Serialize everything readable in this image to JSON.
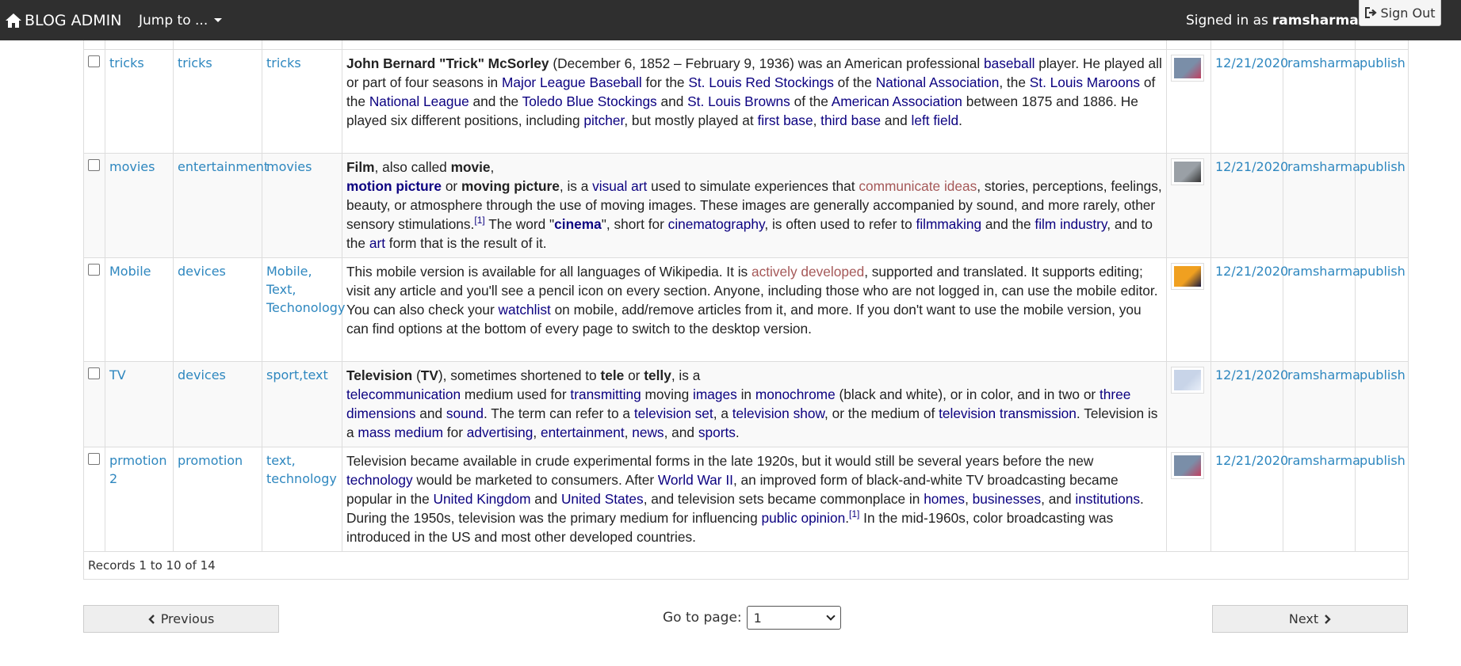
{
  "navbar": {
    "brand": "BLOG ADMIN",
    "jump_to": "Jump to ...",
    "signed_in_prefix": "Signed in as",
    "username": "ramsharma",
    "sign_out": "Sign Out"
  },
  "rows": [
    {
      "title": "tricks",
      "category": "tricks",
      "tags": "tricks",
      "thumb_colors": [
        "#7a8ea8",
        "#c04060"
      ],
      "date": "12/21/2020",
      "author": "ramsharma",
      "status": "publish"
    },
    {
      "title": "movies",
      "category": "entertainment",
      "tags": "movies",
      "thumb_colors": [
        "#9aa0a6",
        "#333333"
      ],
      "date": "12/21/2020",
      "author": "ramsharma",
      "status": "publish"
    },
    {
      "title": "Mobile",
      "category": "devices",
      "tags": "Mobile, Text, Techonology",
      "thumb_colors": [
        "#f0a020",
        "#1a1a40"
      ],
      "date": "12/21/2020",
      "author": "ramsharma",
      "status": "publish"
    },
    {
      "title": "TV",
      "category": "devices",
      "tags": "sport,text",
      "thumb_colors": [
        "#c8d4e8",
        "#e8eef8"
      ],
      "date": "12/21/2020",
      "author": "ramsharma",
      "status": "publish"
    },
    {
      "title": "prmotion 2",
      "category": "promotion",
      "tags": "text, technology",
      "thumb_colors": [
        "#7a8ea8",
        "#c04060"
      ],
      "date": "12/21/2020",
      "author": "ramsharma",
      "status": "publish"
    }
  ],
  "body_texts": {
    "r1": [
      "John Bernard \"Trick\" McSorley",
      " (December 6, 1852 – February 9, 1936) was an American professional ",
      "baseball",
      " player. He played all or part of four seasons in ",
      "Major League Baseball",
      " for the ",
      "St. Louis Red Stockings",
      " of the ",
      "National Association",
      ", the ",
      "St. Louis Maroons",
      " of the ",
      "National League",
      " and the ",
      "Toledo Blue Stockings",
      " and ",
      "St. Louis Browns",
      " of the ",
      "American Association",
      " between 1875 and 1886. He played six different positions, including ",
      "pitcher",
      ", but mostly played at ",
      "first base",
      ", ",
      "third base",
      " and ",
      "left field",
      "."
    ],
    "r2": [
      "Film",
      ", also called ",
      "movie",
      ",",
      "motion picture",
      " or ",
      "moving picture",
      ", is a ",
      "visual art",
      " used to simulate experiences that ",
      "communicate ideas",
      ", stories, perceptions, feelings, beauty, or atmosphere through the use of moving images. These images are generally accompanied by sound, and more rarely, other sensory stimulations.",
      "[1]",
      " The word \"",
      "cinema",
      "\", short for ",
      "cinematography",
      ", is often used to refer to ",
      "filmmaking",
      " and the ",
      "film industry",
      ", and to the ",
      "art",
      " form that is the result of it."
    ],
    "r3": [
      "This mobile version is available for all languages of Wikipedia. It is ",
      "actively developed",
      ", supported and translated. It supports editing; visit any article and you'll see a pencil icon on every section. Anyone, including those who are not logged in, can use the mobile editor. You can also check your ",
      "watchlist",
      " on mobile, add/remove articles from it, and more. If you don't want to use the mobile version, you can find options at the bottom of every page to switch to the desktop version."
    ],
    "r4": [
      "Television",
      " (",
      "TV",
      "), sometimes shortened to ",
      "tele",
      " or ",
      "telly",
      ", is a ",
      "telecommunication",
      " medium used for ",
      "transmitting",
      " moving ",
      "images",
      " in ",
      "monochrome",
      " (black and white), or in color, and in two or ",
      "three dimensions",
      " and ",
      "sound",
      ". The term can refer to a ",
      "television set",
      ", a ",
      "television show",
      ", or the medium of ",
      "television transmission",
      ". Television is a ",
      "mass medium",
      " for ",
      "advertising",
      ", ",
      "entertainment",
      ", ",
      "news",
      ", and ",
      "sports",
      "."
    ],
    "r5": [
      "Television became available in crude experimental forms in the late 1920s, but it would still be several years before the new ",
      "technology",
      " would be marketed to consumers. After ",
      "World War II",
      ", an improved form of black-and-white TV broadcasting became popular in the ",
      "United Kingdom",
      " and ",
      "United States",
      ", and television sets became commonplace in ",
      "homes",
      ", ",
      "businesses",
      ", and ",
      "institutions",
      ". During the 1950s, television was the primary medium for influencing ",
      "public opinion",
      ".",
      "[1]",
      " In the mid-1960s, color broadcasting was introduced in the US and most other developed countries."
    ]
  },
  "footer": {
    "records": "Records 1 to 10 of 14"
  },
  "pager": {
    "previous": "Previous",
    "next": "Next",
    "goto_label": "Go to page:",
    "page_value": "1"
  }
}
